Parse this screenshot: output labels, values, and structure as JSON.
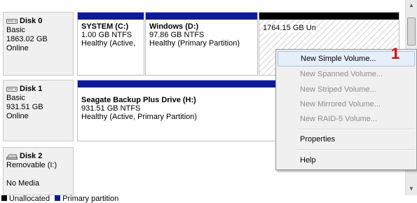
{
  "disks": [
    {
      "name": "Disk 0",
      "type": "Basic",
      "size": "1863.02 GB",
      "status": "Online",
      "icon": "hard-disk-icon",
      "partitions": [
        {
          "name": "SYSTEM  (C:)",
          "size_fs": "1.00 GB NTFS",
          "status": "Healthy (Active,",
          "bar": "primary"
        },
        {
          "name": "Windows  (D:)",
          "size_fs": "97.86 GB NTFS",
          "status": "Healthy (Primary Partition)",
          "bar": "primary"
        },
        {
          "name": "",
          "size_fs": "1764.15 GB",
          "status": "Un",
          "bar": "unallocated"
        }
      ]
    },
    {
      "name": "Disk 1",
      "type": "Basic",
      "size": "931.51 GB",
      "status": "Online",
      "icon": "hard-disk-icon",
      "partitions": [
        {
          "name": "Seagate Backup Plus Drive  (H:)",
          "size_fs": "931.51 GB NTFS",
          "status": "Healthy (Active, Primary Partition)",
          "bar": "primary"
        }
      ]
    },
    {
      "name": "Disk 2",
      "type": "Removable (I:)",
      "size": "",
      "status": "No Media",
      "icon": "removable-disk-icon"
    }
  ],
  "context_menu": {
    "items": [
      {
        "label": "New Simple Volume...",
        "enabled": true,
        "highlighted": true
      },
      {
        "label": "New Spanned Volume...",
        "enabled": false
      },
      {
        "label": "New Striped Volume...",
        "enabled": false
      },
      {
        "label": "New Mirrored Volume...",
        "enabled": false
      },
      {
        "label": "New RAID-5 Volume...",
        "enabled": false
      },
      {
        "label": "Properties",
        "enabled": true
      },
      {
        "label": "Help",
        "enabled": true
      }
    ]
  },
  "annotation": {
    "text": "1",
    "color": "#e00000"
  },
  "legend": [
    {
      "label": "Unallocated",
      "color": "#000000"
    },
    {
      "label": "Primary partition",
      "color": "#0e1a9c"
    }
  ],
  "colors": {
    "primary_bar": "#0e1a9c",
    "unallocated_bar": "#000000",
    "menu_highlight": "#e6eefa"
  }
}
